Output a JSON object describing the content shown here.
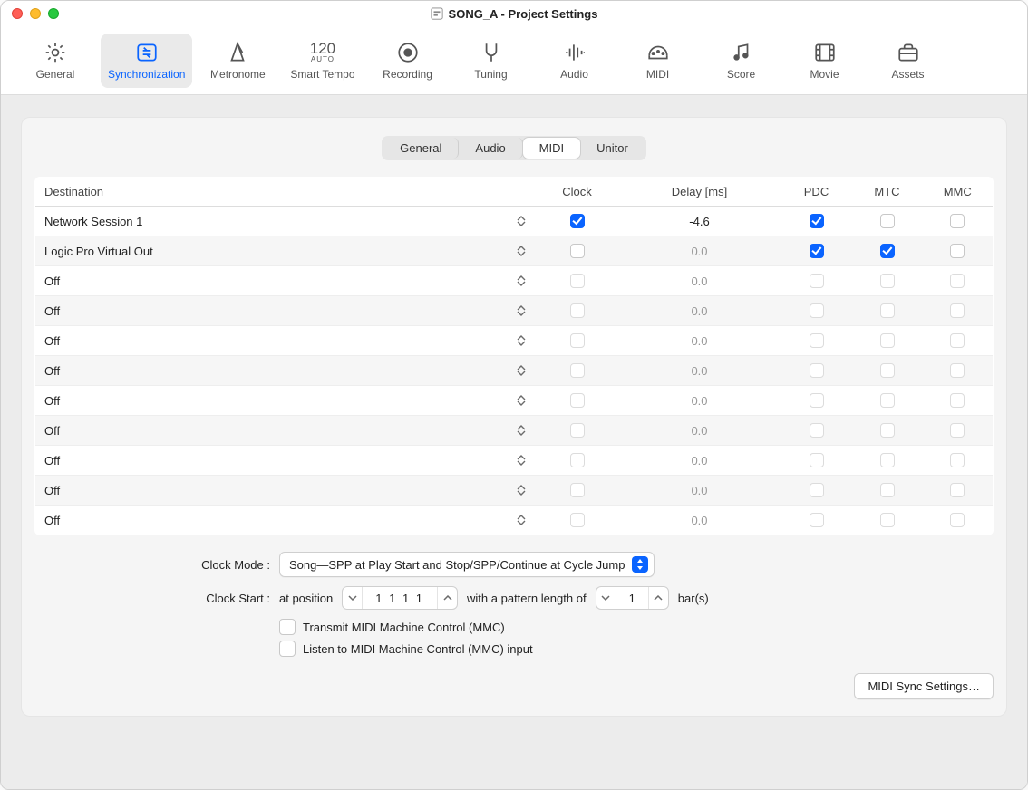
{
  "window_title": "SONG_A - Project Settings",
  "toolbar": [
    {
      "id": "general",
      "label": "General"
    },
    {
      "id": "synchronization",
      "label": "Synchronization"
    },
    {
      "id": "metronome",
      "label": "Metronome"
    },
    {
      "id": "smart-tempo",
      "label": "Smart Tempo",
      "number": "120",
      "sub": "AUTO"
    },
    {
      "id": "recording",
      "label": "Recording"
    },
    {
      "id": "tuning",
      "label": "Tuning"
    },
    {
      "id": "audio",
      "label": "Audio"
    },
    {
      "id": "midi",
      "label": "MIDI"
    },
    {
      "id": "score",
      "label": "Score"
    },
    {
      "id": "movie",
      "label": "Movie"
    },
    {
      "id": "assets",
      "label": "Assets"
    }
  ],
  "toolbar_active": "synchronization",
  "segments": [
    "General",
    "Audio",
    "MIDI",
    "Unitor"
  ],
  "segment_selected": "MIDI",
  "table": {
    "headers": {
      "destination": "Destination",
      "clock": "Clock",
      "delay": "Delay [ms]",
      "pdc": "PDC",
      "mtc": "MTC",
      "mmc": "MMC"
    },
    "rows": [
      {
        "dest": "Network Session 1",
        "clock": true,
        "delay": "-4.6",
        "delay_active": true,
        "pdc": true,
        "mtc": false,
        "mmc": false
      },
      {
        "dest": "Logic Pro Virtual Out",
        "clock": false,
        "delay": "0.0",
        "delay_active": false,
        "pdc": true,
        "mtc": true,
        "mmc": false
      },
      {
        "dest": "Off",
        "clock": false,
        "delay": "0.0",
        "delay_active": false,
        "pdc": false,
        "mtc": false,
        "mmc": false
      },
      {
        "dest": "Off",
        "clock": false,
        "delay": "0.0",
        "delay_active": false,
        "pdc": false,
        "mtc": false,
        "mmc": false
      },
      {
        "dest": "Off",
        "clock": false,
        "delay": "0.0",
        "delay_active": false,
        "pdc": false,
        "mtc": false,
        "mmc": false
      },
      {
        "dest": "Off",
        "clock": false,
        "delay": "0.0",
        "delay_active": false,
        "pdc": false,
        "mtc": false,
        "mmc": false
      },
      {
        "dest": "Off",
        "clock": false,
        "delay": "0.0",
        "delay_active": false,
        "pdc": false,
        "mtc": false,
        "mmc": false
      },
      {
        "dest": "Off",
        "clock": false,
        "delay": "0.0",
        "delay_active": false,
        "pdc": false,
        "mtc": false,
        "mmc": false
      },
      {
        "dest": "Off",
        "clock": false,
        "delay": "0.0",
        "delay_active": false,
        "pdc": false,
        "mtc": false,
        "mmc": false
      },
      {
        "dest": "Off",
        "clock": false,
        "delay": "0.0",
        "delay_active": false,
        "pdc": false,
        "mtc": false,
        "mmc": false
      },
      {
        "dest": "Off",
        "clock": false,
        "delay": "0.0",
        "delay_active": false,
        "pdc": false,
        "mtc": false,
        "mmc": false
      }
    ]
  },
  "clock_mode_label": "Clock Mode :",
  "clock_mode_value": "Song—SPP at Play Start and Stop/SPP/Continue at Cycle Jump",
  "clock_start_label": "Clock Start :",
  "clock_start_prefix": "at position",
  "clock_start_position": "1  1  1      1",
  "clock_start_middle": "with a pattern length of",
  "clock_start_pattern": "1",
  "clock_start_suffix": "bar(s)",
  "transmit_mmc_label": "Transmit MIDI Machine Control (MMC)",
  "listen_mmc_label": "Listen to MIDI Machine Control (MMC) input",
  "midi_sync_button": "MIDI Sync Settings…"
}
